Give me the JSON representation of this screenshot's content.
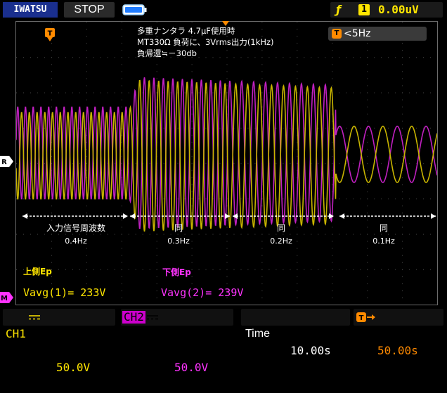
{
  "header": {
    "brand": "IWATSU",
    "run_state": "STOP",
    "trigger_edge_icon": "rising-edge-icon",
    "trigger_channel": "1",
    "trigger_level": "0.00uV"
  },
  "filter_badge": {
    "icon_letter": "T",
    "text": "<5Hz"
  },
  "markers": {
    "trigger_position": "T",
    "ch1_marker": "R",
    "ch2_marker": "M"
  },
  "annotation": {
    "line1": "多重ナンタラ 4.7μF使用時",
    "line2": "MT330Ω 負荷に、3Vrms出力(1kHz)",
    "line3": "負帰還≒－30db"
  },
  "segments": [
    {
      "label": "入力信号周波数",
      "freq": "0.4Hz"
    },
    {
      "label": "同",
      "freq": "0.3Hz"
    },
    {
      "label": "同",
      "freq": "0.2Hz"
    },
    {
      "label": "同",
      "freq": "0.1Hz"
    }
  ],
  "measurements": {
    "ch1_tag": "上側Ep",
    "ch2_tag": "下側Ep",
    "ch1_value": "Vavg(1)= 233V",
    "ch2_value": "Vavg(2)= 239V"
  },
  "footer": {
    "ch1_label": "CH1",
    "ch1_coupling": "DC",
    "ch1_scale": "50.0V",
    "ch2_label": "CH2",
    "ch2_coupling": "DC",
    "ch2_scale": "50.0V",
    "time_label": "Time",
    "time_scale": "10.00s",
    "trigger_offset": "50.00s"
  },
  "colors": {
    "ch1": "#c8b400",
    "ch2": "#c020c0",
    "ch1_text": "#ffe600",
    "ch2_text": "#ff33ff",
    "trigger": "#ff8a00",
    "ch2_box": "#cc00cc"
  }
}
